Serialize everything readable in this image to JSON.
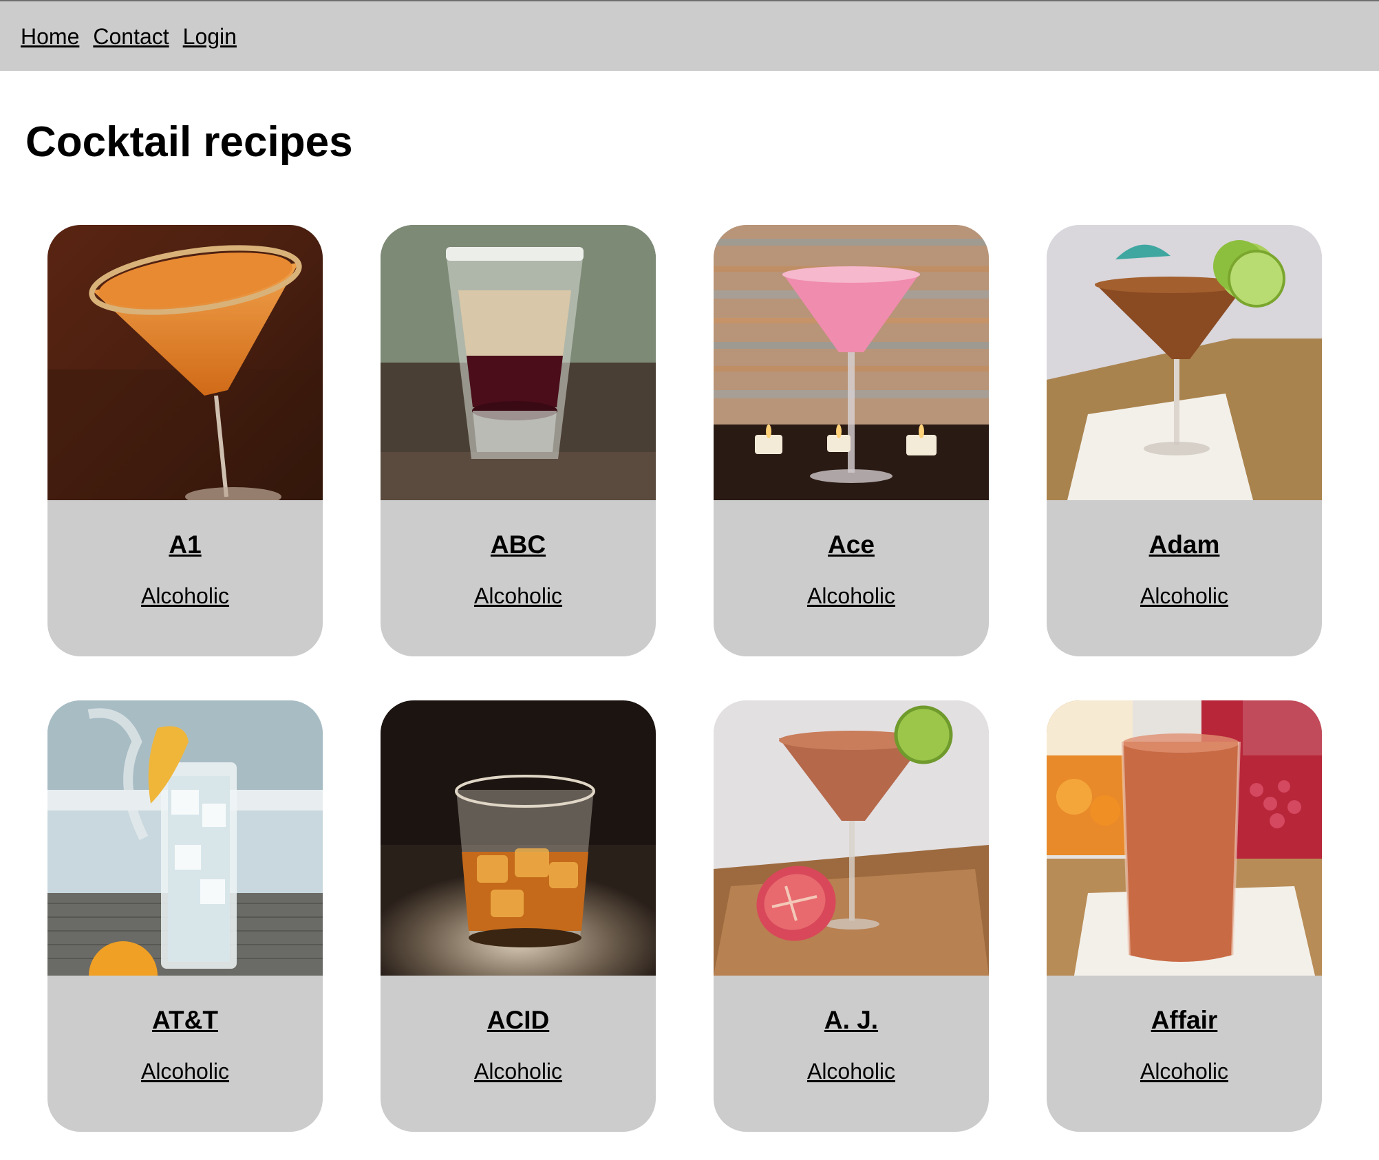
{
  "nav": {
    "links": [
      "Home",
      "Contact",
      "Login"
    ]
  },
  "page": {
    "title": "Cocktail recipes"
  },
  "cocktails": [
    {
      "name": "A1",
      "category": "Alcoholic",
      "image": "cocktail-glass-orange-drink-photo"
    },
    {
      "name": "ABC",
      "category": "Alcoholic",
      "image": "layered-shot-glass-photo"
    },
    {
      "name": "Ace",
      "category": "Alcoholic",
      "image": "pink-martini-candles-photo"
    },
    {
      "name": "Adam",
      "category": "Alcoholic",
      "image": "martini-lime-umbrella-photo"
    },
    {
      "name": "AT&T",
      "category": "Alcoholic",
      "image": "highball-lemon-ice-photo"
    },
    {
      "name": "ACID",
      "category": "Alcoholic",
      "image": "whiskey-rocks-glass-photo"
    },
    {
      "name": "A. J.",
      "category": "Alcoholic",
      "image": "martini-grapefruit-lime-photo"
    },
    {
      "name": "Affair",
      "category": "Alcoholic",
      "image": "juice-cartons-highball-photo"
    }
  ]
}
